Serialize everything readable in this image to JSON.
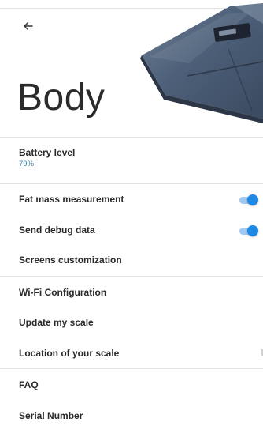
{
  "header": {
    "title": "Body",
    "back_icon": "arrow-left-icon"
  },
  "colors": {
    "toggle_on": "#1e88e5",
    "battery_value": "#3a7fa0"
  },
  "battery": {
    "label": "Battery level",
    "value": "79%"
  },
  "settings": {
    "fat_mass": {
      "label": "Fat mass measurement",
      "enabled": true
    },
    "debug": {
      "label": "Send debug data",
      "enabled": true
    },
    "screens": {
      "label": "Screens customization"
    }
  },
  "scale": {
    "wifi": "Wi-Fi Configuration",
    "update": "Update my scale",
    "location": "Location of your scale"
  },
  "help": {
    "faq": "FAQ",
    "serial": "Serial Number"
  }
}
